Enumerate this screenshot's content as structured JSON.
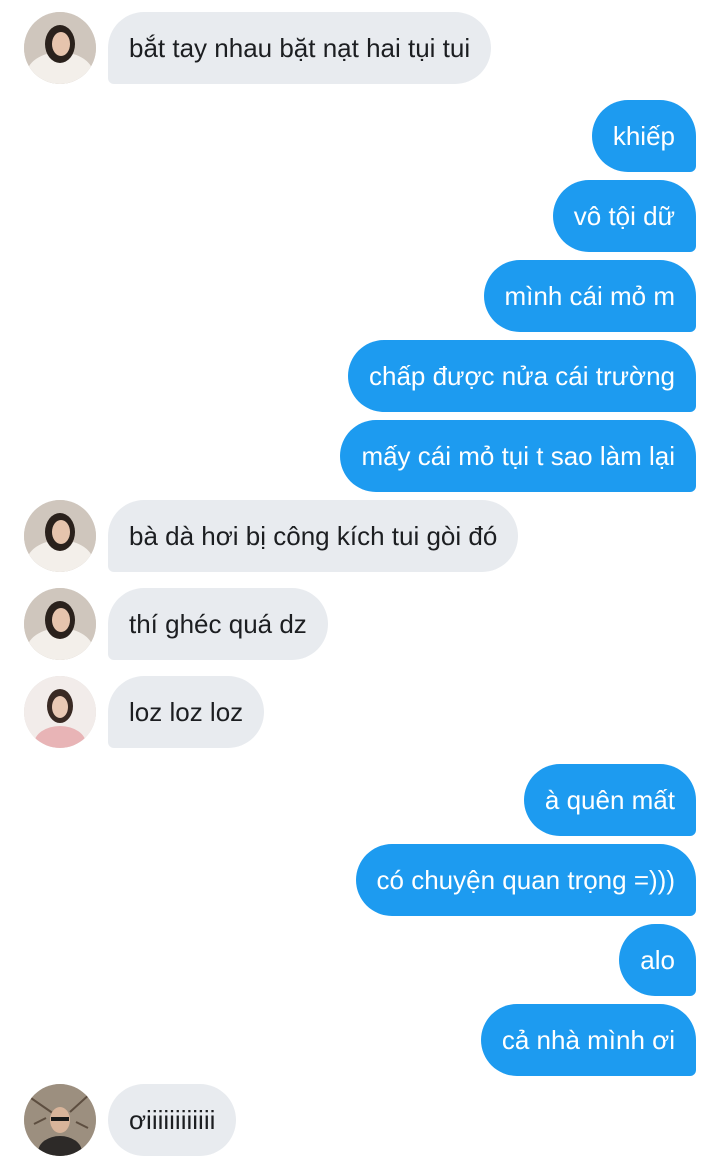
{
  "conversation": {
    "messages": [
      {
        "side": "in",
        "sender": "friend-a",
        "text": "bắt tay nhau bặt nạt hai tụi tui"
      },
      {
        "side": "out",
        "text": "khiếp"
      },
      {
        "side": "out",
        "text": "vô tội dữ"
      },
      {
        "side": "out",
        "text": "mình cái mỏ m"
      },
      {
        "side": "out",
        "text": "chấp được nửa cái trường"
      },
      {
        "side": "out",
        "text": "mấy cái mỏ tụi t sao làm lại"
      },
      {
        "side": "in",
        "sender": "friend-a",
        "text": "bà dà hơi bị công kích tui gòi đó"
      },
      {
        "side": "in",
        "sender": "friend-a",
        "text": "thí ghéc quá dz"
      },
      {
        "side": "in",
        "sender": "friend-b",
        "text": "loz loz loz"
      },
      {
        "side": "out",
        "text": "à quên mất"
      },
      {
        "side": "out",
        "text": "có chuyện quan trọng =)))"
      },
      {
        "side": "out",
        "text": "alo"
      },
      {
        "side": "out",
        "text": "cả nhà mình ơi"
      },
      {
        "side": "in",
        "sender": "friend-c",
        "text": "ơiiiiiiiiiiii"
      }
    ]
  },
  "colors": {
    "outgoing_bubble": "#1d9bf0",
    "incoming_bubble": "#e8ebef",
    "outgoing_text": "#ffffff",
    "incoming_text": "#1c1e21"
  },
  "avatars": {
    "friend-a": "avatar-white-fur-coat",
    "friend-b": "avatar-pink-top",
    "friend-c": "avatar-outdoor-branches"
  }
}
